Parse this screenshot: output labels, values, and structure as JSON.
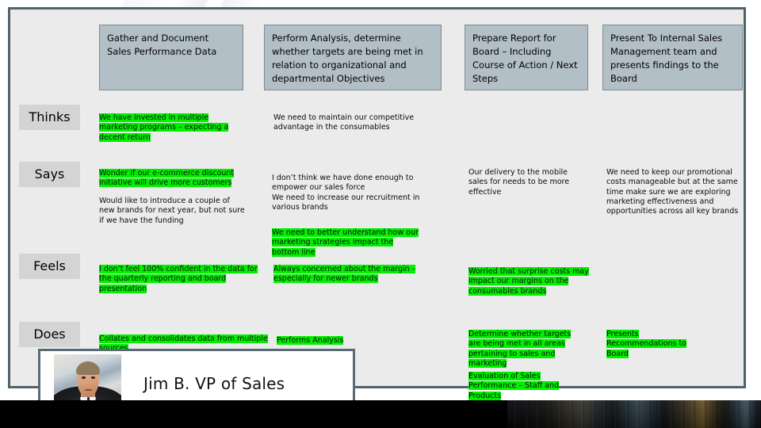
{
  "slide": {
    "columns": [
      {
        "label": "Gather and Document Sales Performance Data"
      },
      {
        "label": "Perform Analysis, determine whether targets are being met in relation to organizational and departmental Objectives"
      },
      {
        "label": "Prepare Report for Board – Including Course of Action / Next Steps"
      },
      {
        "label": "Present To Internal Sales Management team and presents findings to the Board"
      }
    ],
    "rows": [
      {
        "label": "Thinks"
      },
      {
        "label": "Says"
      },
      {
        "label": "Feels"
      },
      {
        "label": "Does"
      }
    ],
    "notes": {
      "thinks_col1": "We have invested in multiple marketing programs – expecting a decent return",
      "thinks_col2": "We need to maintain our competitive advantage in the consumables",
      "says_col1_a": "Wonder if our e-commerce discount initiative will drive more customers",
      "says_col1_b": "Would like to introduce a couple of new brands for next year, but not sure if we have the funding",
      "says_col2_a": "I don’t think we have done enough to empower our sales force\nWe need to increase our recruitment in various brands",
      "says_col2_b": "We need to better understand how our marketing strategies impact the bottom line",
      "says_col3": "Our delivery to the mobile sales for needs to be more effective",
      "says_col4": "We need to keep our promotional costs manageable but at the same time make sure we are exploring marketing effectiveness and opportunities across all key brands",
      "feels_col1": "I don’t feel 100% confident in the data for the quarterly reporting and board presentation",
      "feels_col2": "Always concerned about the margin – especially for newer brands",
      "feels_col3": "Worried that surprise costs may impact our margins on the consumables brands",
      "does_col1": "Collates and consolidates data from multiple sources",
      "does_col2": "Performs Analysis",
      "does_col3_a": "Determine whether targets are being met in all areas pertaining to sales and marketing",
      "does_col3_b": "Evaluation of Sales Performance – Staff and Products",
      "does_col4": "Presents Recommendations to Board"
    },
    "persona": {
      "name": "Jim B.  VP of Sales",
      "photo_alt": "portrait-photo"
    },
    "colors": {
      "highlight": "#00f000",
      "header_box": "#b3bfc6",
      "row_label": "#d4d4d4",
      "slide_border": "#51626b",
      "slide_background": "#ebebeb"
    }
  }
}
